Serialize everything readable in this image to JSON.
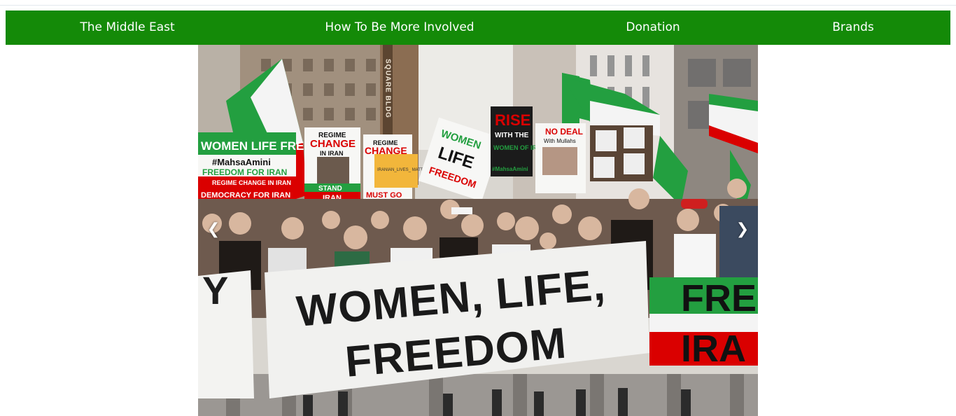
{
  "nav": {
    "items": [
      {
        "label": "The Middle East"
      },
      {
        "label": "How To Be More Involved"
      },
      {
        "label": "Donation"
      },
      {
        "label": "Brands"
      }
    ]
  },
  "slideshow": {
    "prev_glyph": "❮",
    "next_glyph": "❯",
    "image": {
      "banner_line1": "WOMEN, LIFE,",
      "banner_line2": "FREEDOM",
      "right_banner_line1": "FRE",
      "right_banner_line2": "IRA",
      "building_sign": "SQUARE BLDG",
      "signs": {
        "women_life_freedom": "WOMEN LIFE FREEDOM",
        "hashtag": "#MahsaAmini",
        "freedom_for_iran": "FREEDOM FOR IRAN",
        "regime_change_in_iran": "REGIME CHANGE IN IRAN",
        "democracy_for_iran": "DEMOCRACY FOR IRAN",
        "regime": "REGIME",
        "change": "CHANGE",
        "in_iran": "IN IRAN",
        "stand": "STAND",
        "iran": "IRAN",
        "iranian_lives_matter": "IRANIAN_LIVES_ MATTER",
        "must_go": "MUST GO",
        "women": "WOMEN",
        "life": "LIFE",
        "freedom": "FREEDOM",
        "rise": "RISE",
        "with_the": "WITH THE",
        "women_of_iran": "WOMEN OF IRAN",
        "mahsa_amini": "#MahsaAmini",
        "no_deal": "NO DEAL",
        "with_mullahs": "With Mullahs"
      }
    }
  },
  "colors": {
    "nav_green": "#148a08",
    "flag_green": "#239f40",
    "flag_red": "#da0000"
  }
}
